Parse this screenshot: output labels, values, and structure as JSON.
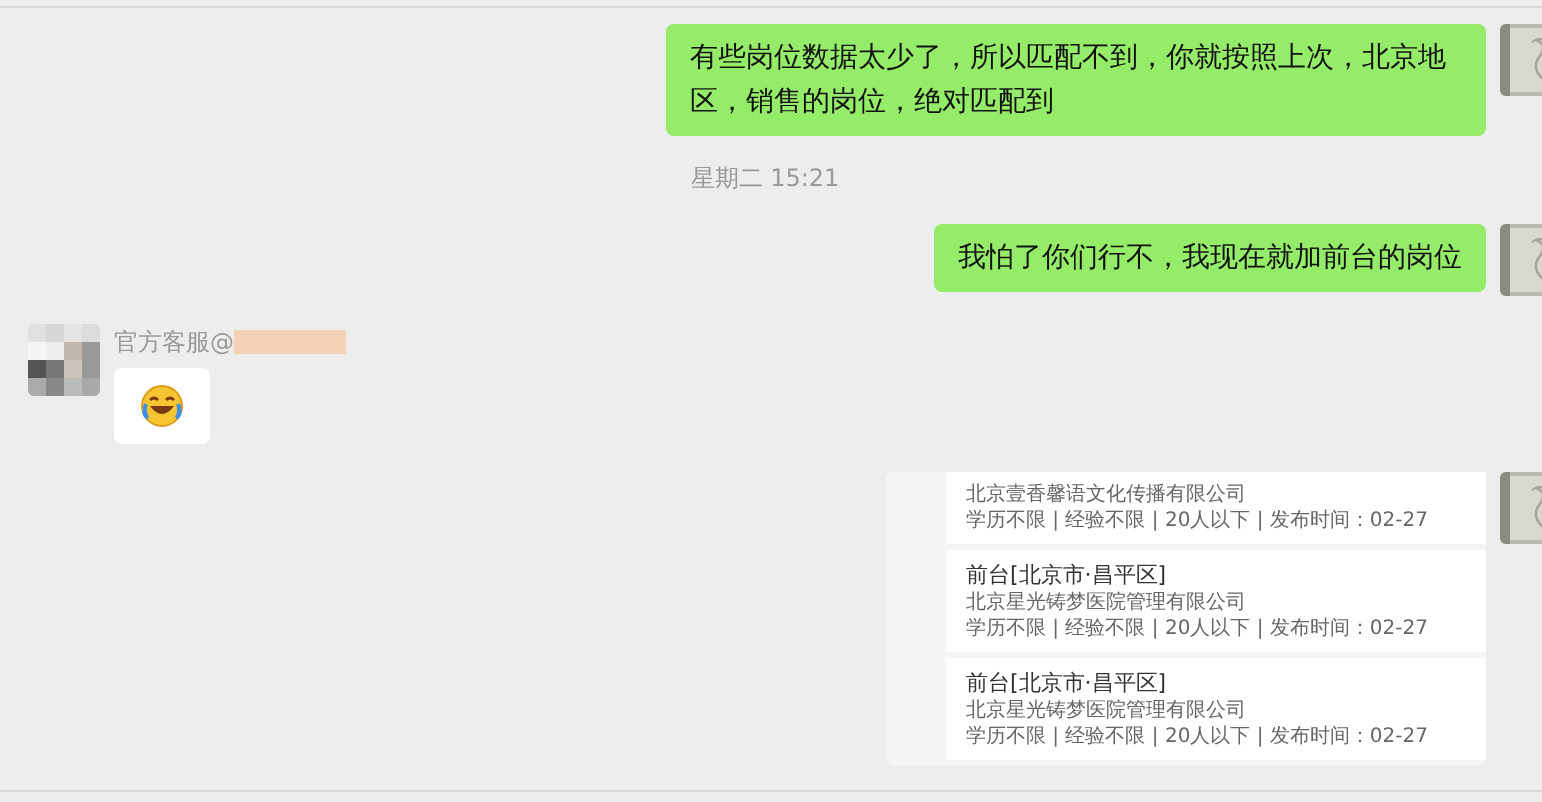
{
  "messages": [
    {
      "kind": "text",
      "outgoing": true,
      "text": "有些岗位数据太少了，所以匹配不到，你就按照上次，北京地区，销售的岗位，绝对匹配到"
    },
    {
      "kind": "time",
      "text": "星期二 15:21"
    },
    {
      "kind": "text",
      "outgoing": true,
      "text": "我怕了你们行不，我现在就加前台的岗位"
    },
    {
      "kind": "sticker",
      "outgoing": false,
      "sender": "官方客服@"
    },
    {
      "kind": "jobs",
      "outgoing": true,
      "cards": [
        {
          "company": "北京壹香馨语文化传播有限公司",
          "meta": "学历不限 | 经验不限 | 20人以下 | 发布时间：02-27"
        },
        {
          "title": "前台[北京市·昌平区]",
          "company": "北京星光铸梦医院管理有限公司",
          "meta": "学历不限 | 经验不限 | 20人以下 | 发布时间：02-27"
        },
        {
          "title": "前台[北京市·昌平区]",
          "company": "北京星光铸梦医院管理有限公司",
          "meta": "学历不限 | 经验不限 | 20人以下 | 发布时间：02-27"
        }
      ]
    }
  ]
}
